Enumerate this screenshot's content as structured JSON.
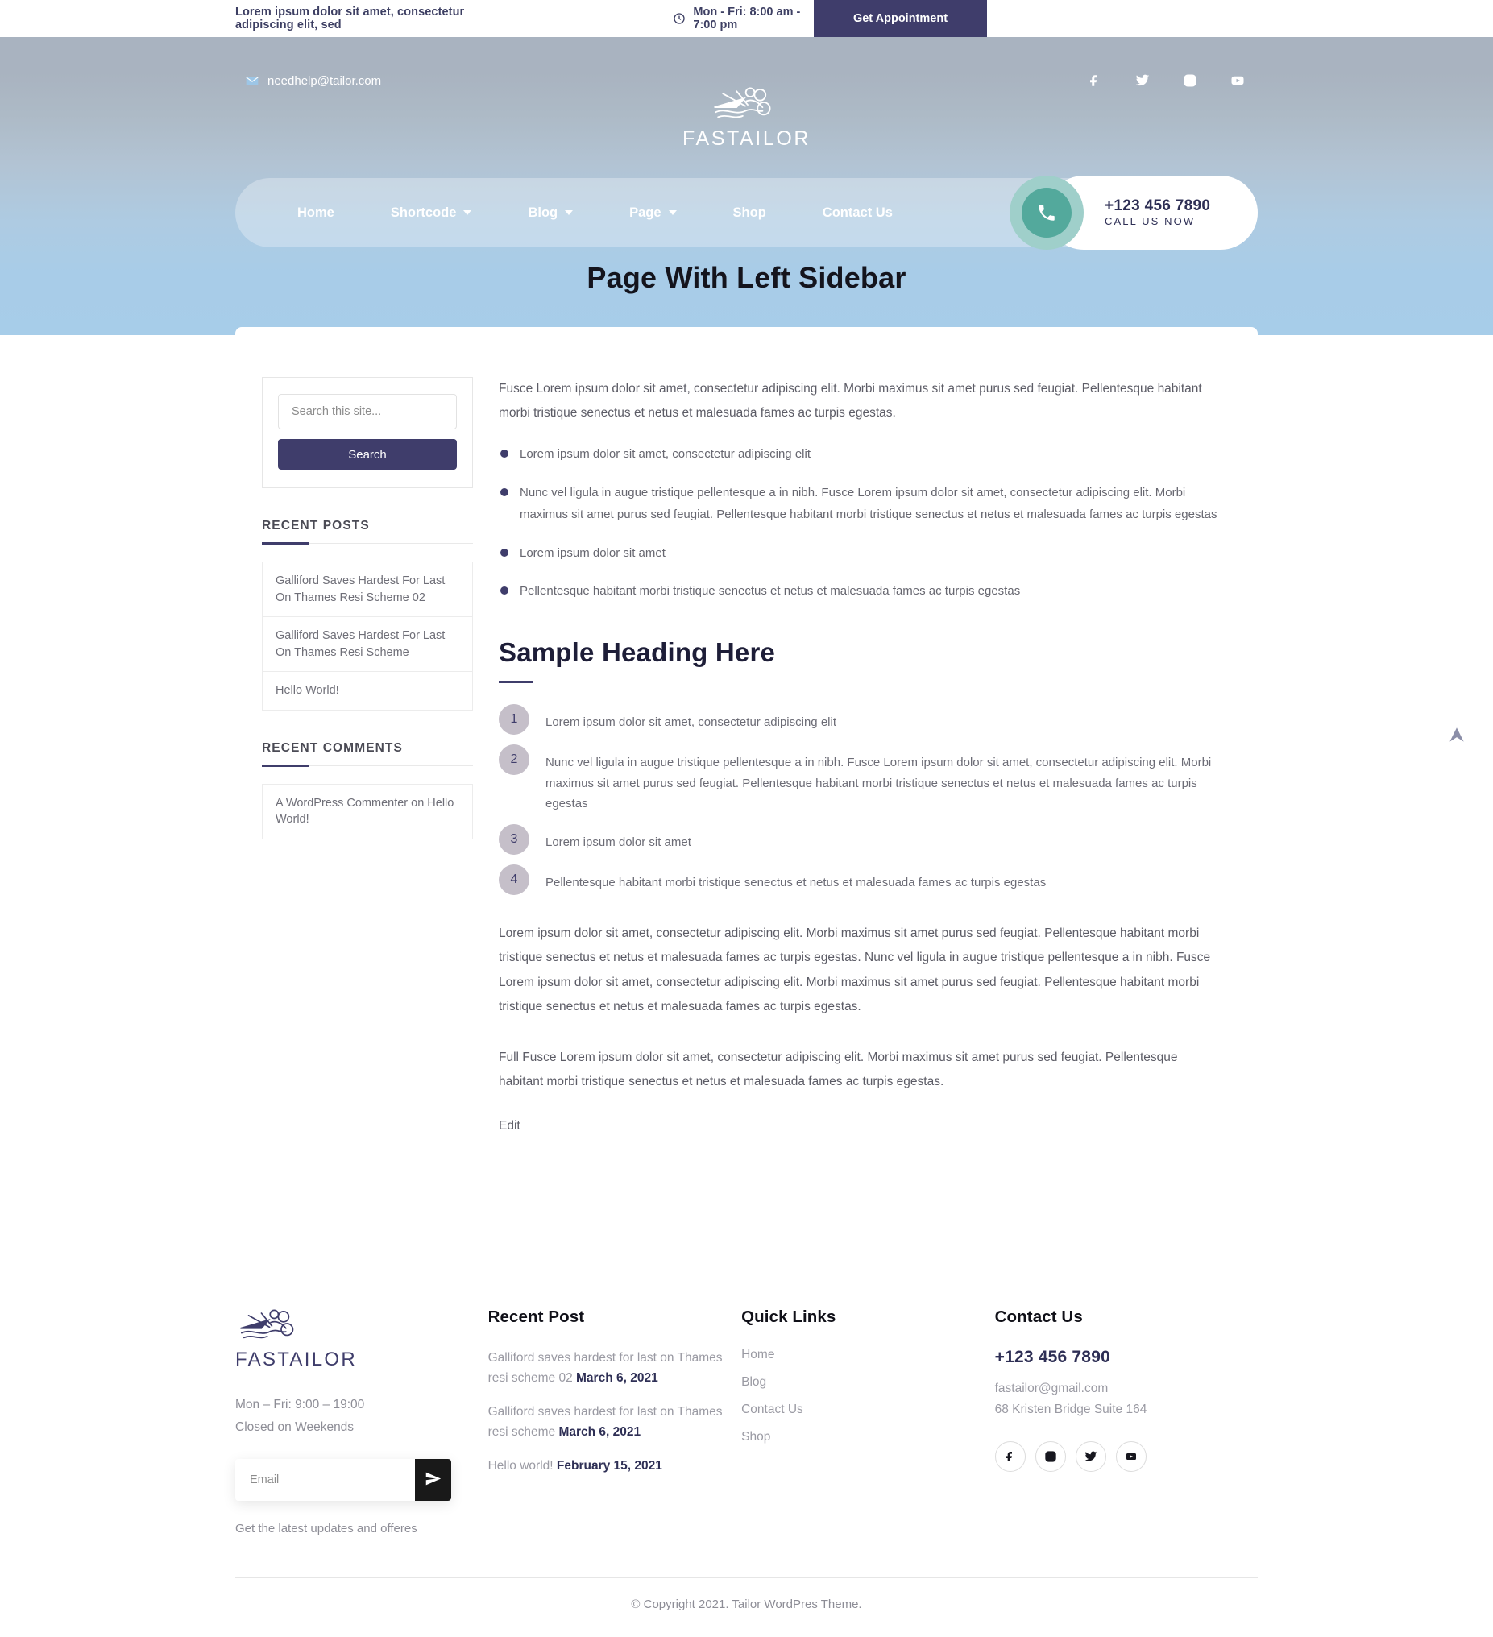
{
  "topbar": {
    "tagline": "Lorem ipsum dolor sit amet, consectetur adipiscing elit, sed",
    "clock_icon": "clock-icon",
    "hours": "Mon - Fri: 8:00 am - 7:00 pm",
    "appointment_label": "Get Appointment"
  },
  "header": {
    "email": "needhelp@tailor.com",
    "mail_icon": "mail-icon",
    "logo_text": "FASTAILOR",
    "logo_icon": "tailor-scissors-logo",
    "social": [
      {
        "name": "facebook-icon",
        "label": "Facebook"
      },
      {
        "name": "twitter-icon",
        "label": "Twitter"
      },
      {
        "name": "instagram-icon",
        "label": "Instagram"
      },
      {
        "name": "youtube-icon",
        "label": "YouTube"
      }
    ],
    "nav": [
      {
        "label": "Home",
        "has_dropdown": false
      },
      {
        "label": "Shortcode",
        "has_dropdown": true
      },
      {
        "label": "Blog",
        "has_dropdown": true
      },
      {
        "label": "Page",
        "has_dropdown": true
      },
      {
        "label": "Shop",
        "has_dropdown": false
      },
      {
        "label": "Contact Us",
        "has_dropdown": false
      }
    ],
    "call": {
      "phone_icon": "phone-icon",
      "number": "+123 456 7890",
      "subtitle": "CALL US NOW"
    }
  },
  "page": {
    "title": "Page With Left Sidebar"
  },
  "sidebar": {
    "search": {
      "placeholder": "Search this site...",
      "value": "",
      "button_label": "Search"
    },
    "recent_posts": {
      "title": "RECENT POSTS",
      "items": [
        "Galliford Saves Hardest For Last On Thames Resi Scheme 02",
        "Galliford Saves Hardest For Last On Thames Resi Scheme",
        "Hello World!"
      ]
    },
    "recent_comments": {
      "title": "RECENT COMMENTS",
      "items": [
        "A WordPress Commenter on Hello World!"
      ]
    }
  },
  "main": {
    "intro": "Fusce Lorem ipsum dolor sit amet, consectetur adipiscing elit. Morbi maximus sit amet purus sed feugiat. Pellentesque habitant morbi tristique senectus et netus et malesuada fames ac turpis egestas.",
    "bullets": [
      "Lorem ipsum dolor sit amet, consectetur adipiscing elit",
      "Nunc vel ligula in augue tristique pellentesque a in nibh. Fusce Lorem ipsum dolor sit amet, consectetur adipiscing elit. Morbi maximus sit amet purus sed feugiat. Pellentesque habitant morbi tristique senectus et netus et malesuada fames ac turpis egestas",
      "Lorem ipsum dolor sit amet",
      "Pellentesque habitant morbi tristique senectus et netus et malesuada fames ac turpis egestas"
    ],
    "heading": "Sample Heading Here",
    "numbered": [
      {
        "num": "1",
        "text": "Lorem ipsum dolor sit amet, consectetur adipiscing elit"
      },
      {
        "num": "2",
        "text": "Nunc vel ligula in augue tristique pellentesque a in nibh. Fusce Lorem ipsum dolor sit amet, consectetur adipiscing elit. Morbi maximus sit amet purus sed feugiat. Pellentesque habitant morbi tristique senectus et netus et malesuada fames ac turpis egestas"
      },
      {
        "num": "3",
        "text": "Lorem ipsum dolor sit amet"
      },
      {
        "num": "4",
        "text": "Pellentesque habitant morbi tristique senectus et netus et malesuada fames ac turpis egestas"
      }
    ],
    "paragraph1": "Lorem ipsum dolor sit amet, consectetur adipiscing elit. Morbi maximus sit amet purus sed feugiat. Pellentesque habitant morbi tristique senectus et netus et malesuada fames ac turpis egestas. Nunc vel ligula in augue tristique pellentesque a in nibh. Fusce Lorem ipsum dolor sit amet, consectetur adipiscing elit. Morbi maximus sit amet purus sed feugiat. Pellentesque habitant morbi tristique senectus et netus et malesuada fames ac turpis egestas.",
    "paragraph2": "Full Fusce Lorem ipsum dolor sit amet, consectetur adipiscing elit. Morbi maximus sit amet purus sed feugiat. Pellentesque habitant morbi tristique senectus et netus et malesuada fames ac turpis egestas.",
    "edit_label": "Edit"
  },
  "scroll_top": {
    "icon": "arrow-up-icon"
  },
  "footer": {
    "brand": {
      "logo_text": "FASTAILOR",
      "logo_icon": "tailor-scissors-logo",
      "hours_line1": "Mon – Fri: 9:00 – 19:00",
      "hours_line2": "Closed on Weekends",
      "email_placeholder": "Email",
      "email_value": "",
      "send_icon": "send-icon",
      "note": "Get the latest updates and offeres"
    },
    "recent_post": {
      "title": "Recent Post",
      "items": [
        {
          "text": "Galliford saves hardest for last on Thames resi scheme 02",
          "date": "March 6, 2021"
        },
        {
          "text": "Galliford saves hardest for last on Thames resi scheme",
          "date": "March 6, 2021"
        },
        {
          "text": "Hello world!",
          "date": "February 15, 2021"
        }
      ]
    },
    "quick_links": {
      "title": "Quick Links",
      "items": [
        "Home",
        "Blog",
        "Contact Us",
        "Shop"
      ]
    },
    "contact": {
      "title": "Contact Us",
      "phone": "+123 456 7890",
      "email": "fastailor@gmail.com",
      "address": "68 Kristen Bridge Suite 164",
      "social": [
        {
          "name": "facebook-icon",
          "label": "Facebook"
        },
        {
          "name": "instagram-icon",
          "label": "Instagram"
        },
        {
          "name": "twitter-icon",
          "label": "Twitter"
        },
        {
          "name": "youtube-icon",
          "label": "YouTube"
        }
      ]
    },
    "copyright": "© Copyright 2021. Tailor WordPres Theme."
  },
  "colors": {
    "primary": "#3f3d6b",
    "accent_teal": "#53a99c",
    "dark": "#2e2f55"
  }
}
